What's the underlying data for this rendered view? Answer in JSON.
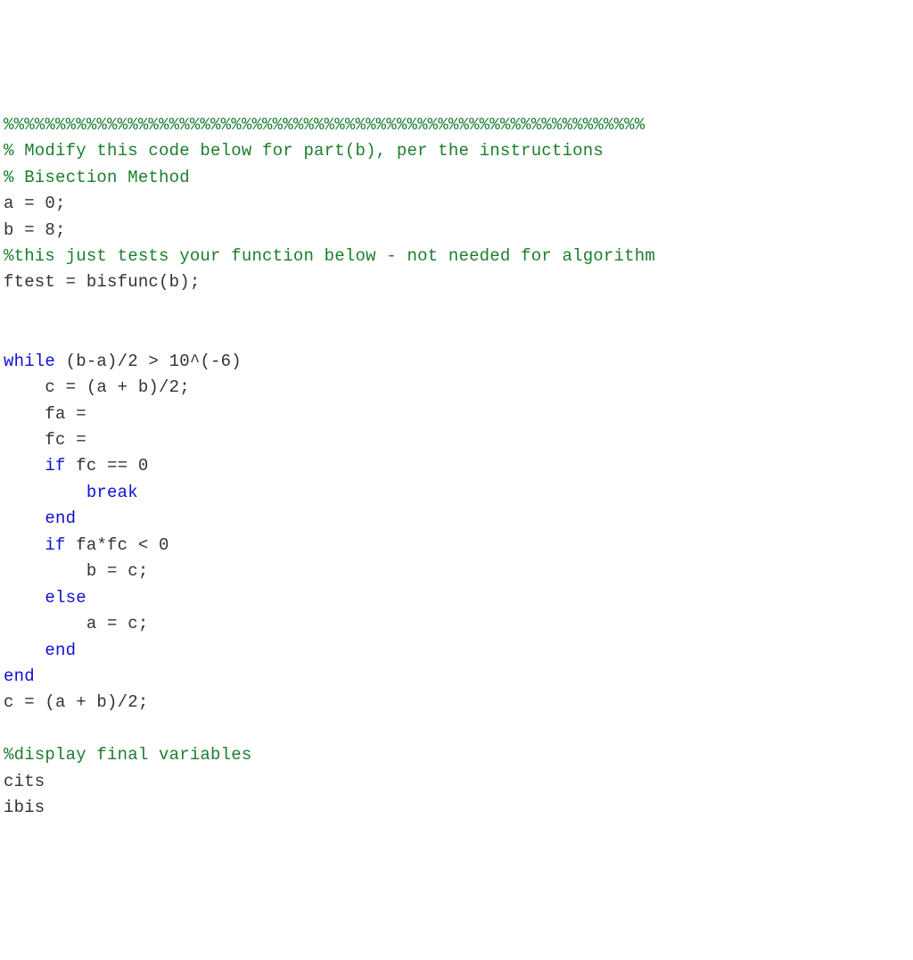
{
  "lines": [
    {
      "type": "comment",
      "text": "%%%%%%%%%%%%%%%%%%%%%%%%%%%%%%%%%%%%%%%%%%%%%%%%%%%%%%%%%%%%%%"
    },
    {
      "type": "comment",
      "text": "% Modify this code below for part(b), per the instructions"
    },
    {
      "type": "comment",
      "text": "% Bisection Method"
    },
    {
      "type": "code",
      "text": "a = 0;"
    },
    {
      "type": "code",
      "text": "b = 8;"
    },
    {
      "type": "comment",
      "text": "%this just tests your function below - not needed for algorithm"
    },
    {
      "type": "code",
      "text": "ftest = bisfunc(b);"
    },
    {
      "type": "blank",
      "text": ""
    },
    {
      "type": "blank",
      "text": ""
    },
    {
      "type": "mixed",
      "segments": [
        {
          "cls": "keyword",
          "text": "while"
        },
        {
          "cls": "code",
          "text": " (b-a)/2 > 10^(-6)"
        }
      ]
    },
    {
      "type": "code",
      "text": "    c = (a + b)/2;"
    },
    {
      "type": "code",
      "text": "    fa ="
    },
    {
      "type": "code",
      "text": "    fc ="
    },
    {
      "type": "mixed",
      "segments": [
        {
          "cls": "code",
          "text": "    "
        },
        {
          "cls": "keyword",
          "text": "if"
        },
        {
          "cls": "code",
          "text": " fc == 0"
        }
      ]
    },
    {
      "type": "mixed",
      "segments": [
        {
          "cls": "code",
          "text": "        "
        },
        {
          "cls": "keyword",
          "text": "break"
        }
      ]
    },
    {
      "type": "mixed",
      "segments": [
        {
          "cls": "code",
          "text": "    "
        },
        {
          "cls": "keyword",
          "text": "end"
        }
      ]
    },
    {
      "type": "mixed",
      "segments": [
        {
          "cls": "code",
          "text": "    "
        },
        {
          "cls": "keyword",
          "text": "if"
        },
        {
          "cls": "code",
          "text": " fa*fc < 0"
        }
      ]
    },
    {
      "type": "code",
      "text": "        b = c;"
    },
    {
      "type": "mixed",
      "segments": [
        {
          "cls": "code",
          "text": "    "
        },
        {
          "cls": "keyword",
          "text": "else"
        }
      ]
    },
    {
      "type": "code",
      "text": "        a = c;"
    },
    {
      "type": "mixed",
      "segments": [
        {
          "cls": "code",
          "text": "    "
        },
        {
          "cls": "keyword",
          "text": "end"
        }
      ]
    },
    {
      "type": "keyword",
      "text": "end"
    },
    {
      "type": "code",
      "text": "c = (a + b)/2;"
    },
    {
      "type": "blank",
      "text": ""
    },
    {
      "type": "comment",
      "text": "%display final variables"
    },
    {
      "type": "code",
      "text": "cits"
    },
    {
      "type": "code",
      "text": "ibis"
    }
  ]
}
